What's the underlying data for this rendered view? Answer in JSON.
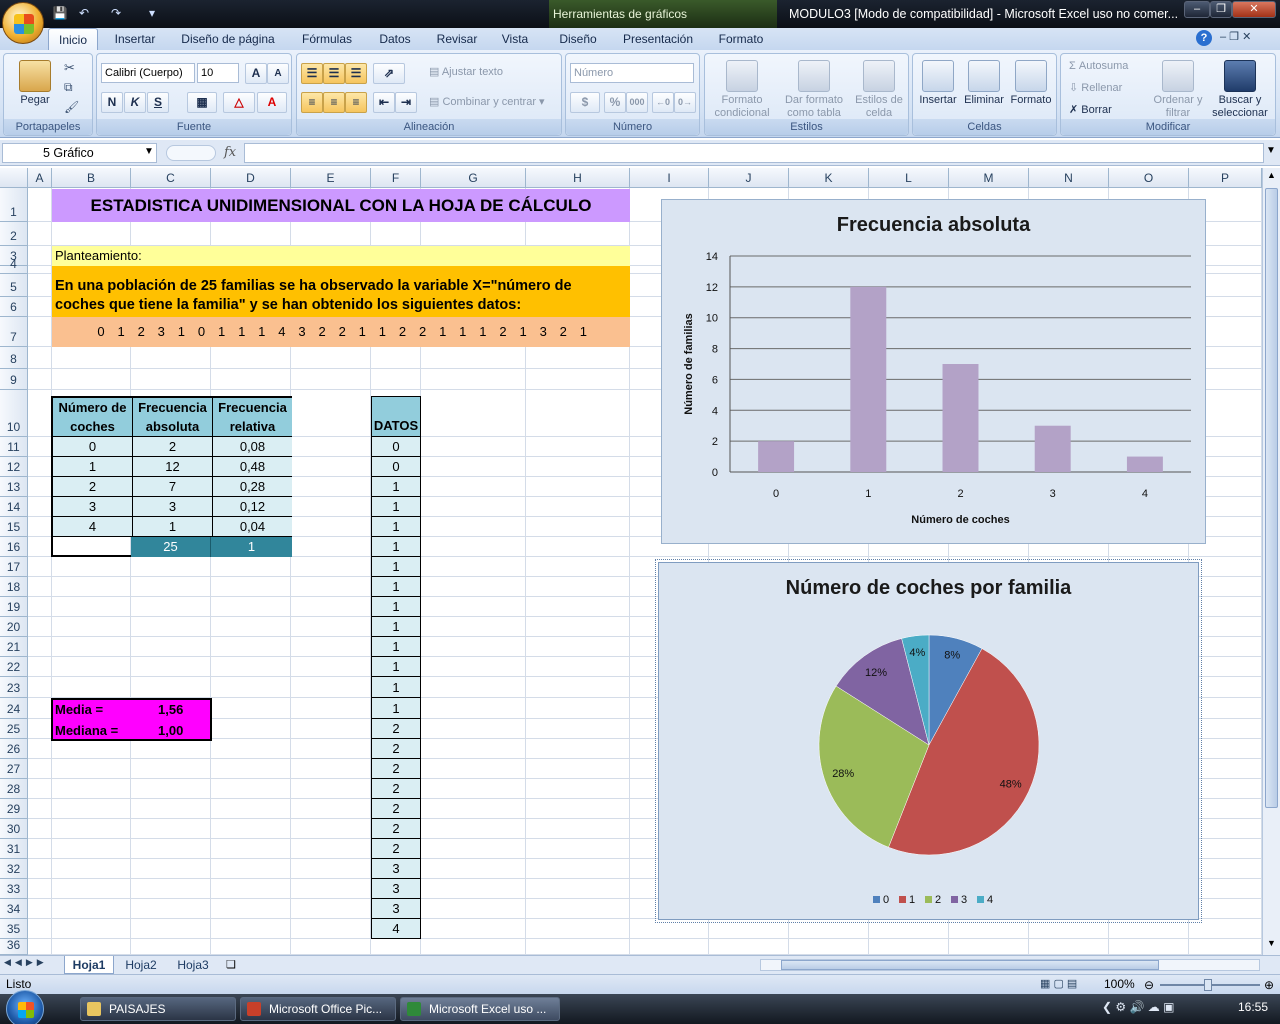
{
  "window": {
    "contextual_tab_group": "Herramientas de gráficos",
    "title": "MODULO3  [Modo de compatibilidad] - Microsoft Excel uso no comer...",
    "help_icon": "?"
  },
  "ribbon": {
    "tabs": [
      "Inicio",
      "Insertar",
      "Diseño de página",
      "Fórmulas",
      "Datos",
      "Revisar",
      "Vista",
      "Diseño",
      "Presentación",
      "Formato"
    ],
    "active_tab": "Inicio",
    "clipboard": {
      "paste": "Pegar",
      "label": "Portapapeles"
    },
    "font": {
      "name": "Calibri (Cuerpo)",
      "size": "10",
      "bold": "N",
      "italic": "K",
      "underline": "S",
      "grow": "A",
      "shrink": "A",
      "font_color": "A",
      "label": "Fuente"
    },
    "alignment": {
      "wrap": "Ajustar texto",
      "merge": "Combinar y centrar",
      "label": "Alineación"
    },
    "number": {
      "format": "Número",
      "percent": "%",
      "thousands": "000",
      "label": "Número"
    },
    "styles": {
      "conditional": "Formato condicional",
      "as_table": "Dar formato como tabla",
      "cell_styles": "Estilos de celda",
      "label": "Estilos"
    },
    "cells": {
      "insert": "Insertar",
      "delete": "Eliminar",
      "format": "Formato",
      "label": "Celdas"
    },
    "modify": {
      "autosum": "Autosuma",
      "fill": "Rellenar",
      "clear": "Borrar",
      "sort": "Ordenar y filtrar",
      "find": "Buscar y seleccionar",
      "label": "Modificar"
    }
  },
  "formula_bar": {
    "name_box": "5 Gráfico",
    "fx": "fx",
    "formula": ""
  },
  "sheet": {
    "columns": [
      "A",
      "B",
      "C",
      "D",
      "E",
      "F",
      "G",
      "H",
      "I",
      "J",
      "K",
      "L",
      "M",
      "N",
      "O",
      "P"
    ],
    "rows": [
      "1",
      "2",
      "3",
      "4",
      "5",
      "6",
      "7",
      "8",
      "9",
      "10",
      "11",
      "12",
      "13",
      "14",
      "15",
      "16",
      "17",
      "18",
      "19",
      "20",
      "21",
      "22",
      "23",
      "24",
      "25",
      "26",
      "27",
      "28",
      "29",
      "30",
      "31",
      "32",
      "33",
      "34",
      "35",
      "36"
    ],
    "title": "ESTADISTICA UNIDIMENSIONAL CON LA HOJA DE CÁLCULO",
    "statement_label": "Planteamiento:",
    "statement_line1": "En una población de 25 familias se ha observado la variable X=\"número de",
    "statement_line2": "coches que tiene la familia\" y se han obtenido los siguientes datos:",
    "raw_data": [
      "0",
      "1",
      "2",
      "3",
      "1",
      "0",
      "1",
      "1",
      "1",
      "4",
      "3",
      "2",
      "2",
      "1",
      "1",
      "2",
      "2",
      "1",
      "1",
      "1",
      "2",
      "1",
      "3",
      "2",
      "1"
    ],
    "freq_table": {
      "headers": [
        [
          "Número de",
          "coches"
        ],
        [
          "Frecuencia",
          "absoluta"
        ],
        [
          "Frecuencia",
          "relativa"
        ]
      ],
      "rows": [
        [
          "0",
          "2",
          "0,08"
        ],
        [
          "1",
          "12",
          "0,48"
        ],
        [
          "2",
          "7",
          "0,28"
        ],
        [
          "3",
          "3",
          "0,12"
        ],
        [
          "4",
          "1",
          "0,04"
        ]
      ],
      "totals": [
        "25",
        "1"
      ]
    },
    "datos_header": "DATOS",
    "datos": [
      "0",
      "0",
      "1",
      "1",
      "1",
      "1",
      "1",
      "1",
      "1",
      "1",
      "1",
      "1",
      "1",
      "1",
      "2",
      "2",
      "2",
      "2",
      "2",
      "2",
      "2",
      "3",
      "3",
      "3",
      "4"
    ],
    "media_label": "Media =",
    "media_value": "1,56",
    "mediana_label": "Mediana =",
    "mediana_value": "1,00",
    "colors": {
      "title_bg": "#cc99ff",
      "statement_bg": "#ffff99",
      "text_bg": "#ffc000",
      "data_bg": "#fac090",
      "table_header": "#92cddc",
      "table_body": "#daeef3",
      "totals": "#31869b",
      "stats_bg": "#ff00ff"
    }
  },
  "chart_data": [
    {
      "type": "bar",
      "title": "Frecuencia absoluta",
      "xlabel": "Número de coches",
      "ylabel": "Número de familias",
      "categories": [
        "0",
        "1",
        "2",
        "3",
        "4"
      ],
      "values": [
        2,
        12,
        7,
        3,
        1
      ],
      "ylim": [
        0,
        14
      ],
      "yticks": [
        "0",
        "2",
        "4",
        "6",
        "8",
        "10",
        "12",
        "14"
      ],
      "grid": true,
      "color": "#b3a2c7"
    },
    {
      "type": "pie",
      "title": "Número de coches por familia",
      "categories": [
        "0",
        "1",
        "2",
        "3",
        "4"
      ],
      "values": [
        8,
        48,
        28,
        12,
        4
      ],
      "labels": [
        "8%",
        "48%",
        "28%",
        "12%",
        "4%"
      ],
      "colors": [
        "#4f81bd",
        "#c0504d",
        "#9bbb59",
        "#8064a2",
        "#4bacc6"
      ],
      "legend": "bottom"
    }
  ],
  "sheet_tabs": [
    "Hoja1",
    "Hoja2",
    "Hoja3"
  ],
  "active_sheet": "Hoja1",
  "status": {
    "mode": "Listo",
    "zoom": "100%"
  },
  "taskbar": {
    "items": [
      "PAISAJES",
      "Microsoft Office Pic...",
      "Microsoft Excel uso ..."
    ],
    "clock": "16:55"
  }
}
